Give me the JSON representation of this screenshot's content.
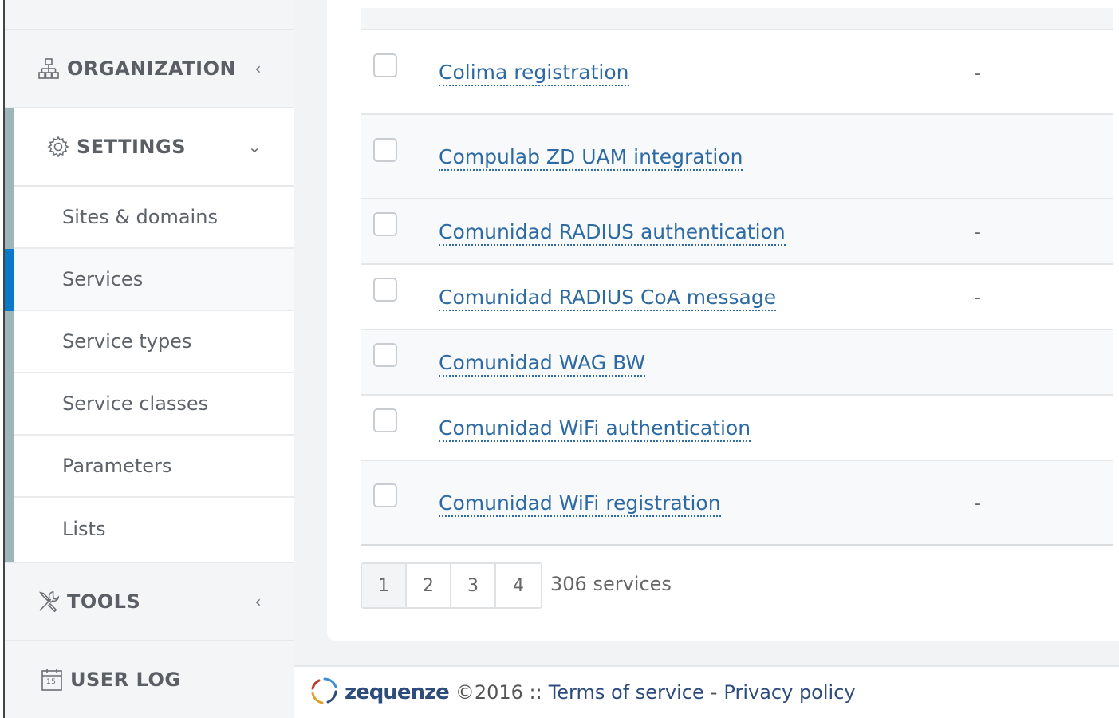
{
  "sidebar": {
    "organization": "ORGANIZATION",
    "settings": "SETTINGS",
    "settings_items": [
      {
        "label": "Sites & domains"
      },
      {
        "label": "Services"
      },
      {
        "label": "Service types"
      },
      {
        "label": "Service classes"
      },
      {
        "label": "Parameters"
      },
      {
        "label": "Lists"
      }
    ],
    "active_item": "Services",
    "tools": "TOOLS",
    "user_log": "USER LOG",
    "calendar_day": "15"
  },
  "services": {
    "rows": [
      {
        "name": "Colima registration",
        "value": "-"
      },
      {
        "name": "Compulab ZD UAM integration",
        "value": ""
      },
      {
        "name": "Comunidad RADIUS authentication",
        "value": "-"
      },
      {
        "name": "Comunidad RADIUS CoA message",
        "value": "-"
      },
      {
        "name": "Comunidad WAG BW",
        "value": ""
      },
      {
        "name": "Comunidad WiFi authentication",
        "value": ""
      },
      {
        "name": "Comunidad WiFi registration",
        "value": "-"
      }
    ],
    "pages": [
      "1",
      "2",
      "3",
      "4"
    ],
    "current_page": "1",
    "count_text": "306 services"
  },
  "footer": {
    "brand": "zequenze",
    "copyright": "©2016 ::",
    "terms": "Terms of service",
    "separator": "-",
    "privacy": "Privacy policy"
  },
  "colors": {
    "accent": "#0b79c9",
    "link": "#2d6aa3",
    "brand": "#2d4c7c",
    "settings_border": "#9fb6b8"
  }
}
